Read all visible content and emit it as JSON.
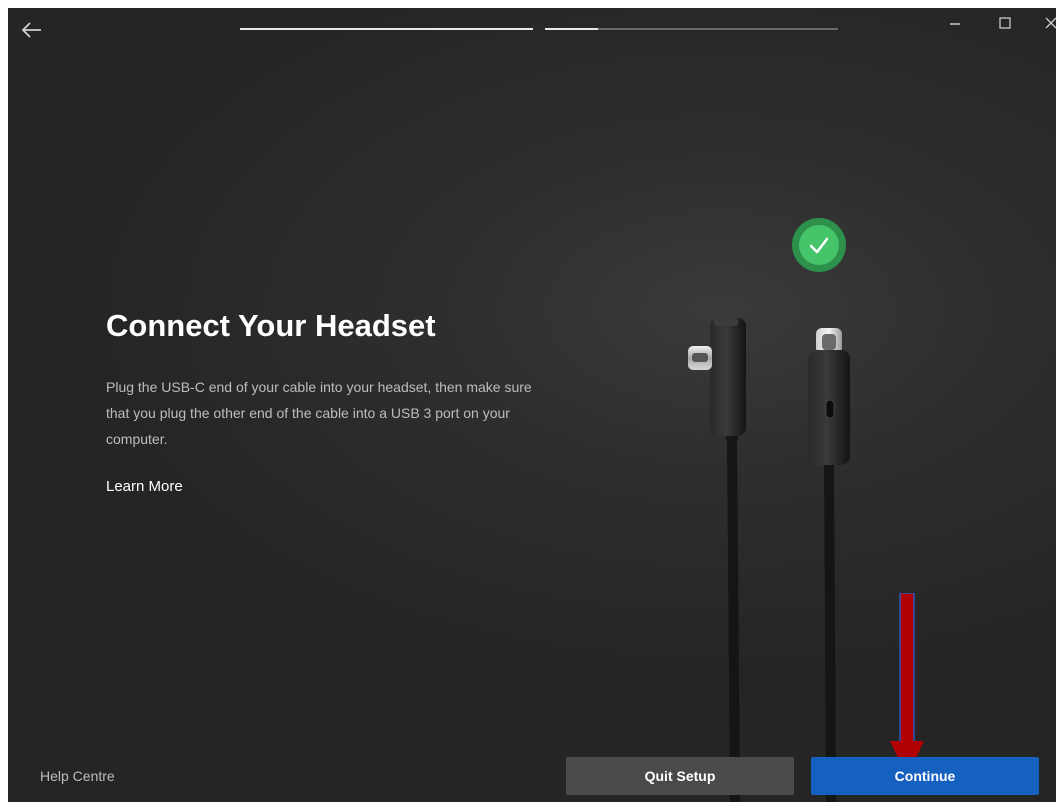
{
  "header": {
    "back_icon": "arrow-left-icon",
    "progress": [
      {
        "step": 1,
        "fill": 1.0
      },
      {
        "step": 2,
        "fill": 0.18
      }
    ],
    "window_controls": [
      "minimize-icon",
      "maximize-icon",
      "close-icon"
    ]
  },
  "main": {
    "title": "Connect Your Headset",
    "description": "Plug the USB-C end of your cable into your headset, then make sure that you plug the other end of the cable into a USB 3 port on your computer.",
    "learn_more_label": "Learn More",
    "status_icon": "checkmark-circle-icon",
    "illustration": "usb-c-cable-icon"
  },
  "footer": {
    "help_label": "Help Centre",
    "quit_label": "Quit Setup",
    "continue_label": "Continue"
  },
  "colors": {
    "background": "#2e2e2e",
    "accent": "#1660c0",
    "secondary_button": "#4a4a4a",
    "success": "#3cc46a",
    "annotation_arrow": "#b00000"
  }
}
